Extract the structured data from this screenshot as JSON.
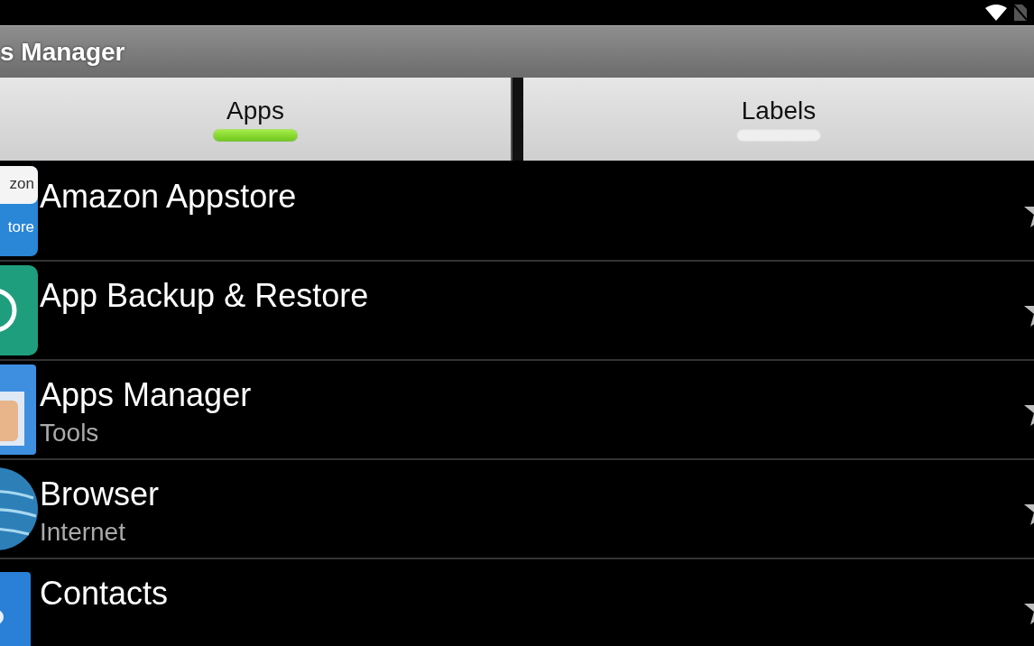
{
  "window": {
    "title": "s Manager"
  },
  "tabs": [
    {
      "label": "Apps",
      "selected": true
    },
    {
      "label": "Labels",
      "selected": false
    }
  ],
  "apps": [
    {
      "name": "Amazon Appstore",
      "icon_text": [
        "zon",
        "tore"
      ]
    },
    {
      "name": "App Backup & Restore"
    },
    {
      "name": "Apps Manager",
      "category": "Tools"
    },
    {
      "name": "Browser",
      "category": "Internet"
    },
    {
      "name": "Contacts"
    }
  ]
}
